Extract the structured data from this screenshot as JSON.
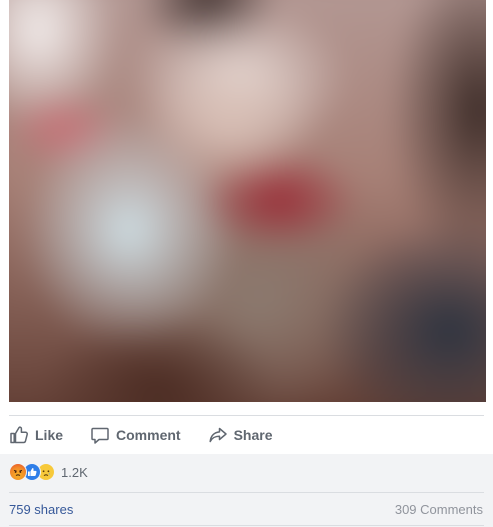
{
  "post": {
    "image": {
      "alt": "blurred photo",
      "blurred": true
    },
    "actions": {
      "like_label": "Like",
      "comment_label": "Comment",
      "share_label": "Share"
    },
    "reactions": {
      "icons": [
        "angry-reaction-icon",
        "like-reaction-icon",
        "sad-reaction-icon"
      ],
      "count": "1.2K"
    },
    "stats": {
      "shares": "759 shares",
      "comments": "309 Comments"
    },
    "colors": {
      "action_text": "#606770",
      "link_blue": "#365899",
      "muted": "#90949c",
      "footer_bg": "#f2f3f5",
      "like_blue": "#2f7ee8"
    }
  }
}
